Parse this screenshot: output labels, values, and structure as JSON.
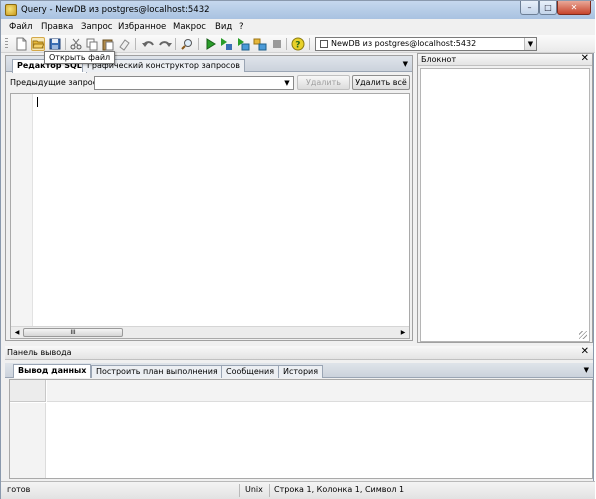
{
  "window": {
    "title": "Query - NewDB из postgres@localhost:5432",
    "controls": {
      "minimize": "–",
      "maximize": "□",
      "close": "✕"
    }
  },
  "menubar": {
    "items": [
      {
        "label": "Файл"
      },
      {
        "label": "Правка"
      },
      {
        "label": "Запрос"
      },
      {
        "label": "Избранное"
      },
      {
        "label": "Макрос"
      },
      {
        "label": "Вид"
      },
      {
        "label": "?"
      }
    ]
  },
  "toolbar": {
    "icons": [
      "new-file-icon",
      "open-file-icon",
      "save-icon",
      "cut-icon",
      "copy-icon",
      "paste-icon",
      "clear-icon",
      "undo-icon",
      "redo-icon",
      "find-icon",
      "execute-icon",
      "execute-to-file-icon",
      "explain-icon",
      "explain-analyze-icon",
      "cancel-query-icon",
      "help-icon"
    ],
    "connection": "NewDB из postgres@localhost:5432"
  },
  "tooltip": {
    "text": "Открыть файл"
  },
  "editor": {
    "tabs": [
      {
        "label": "Редактор SQL",
        "active": true
      },
      {
        "label": "Графический конструктор запросов",
        "active": false
      }
    ],
    "previous_queries_label": "Предыдущие запросы",
    "previous_queries_value": "",
    "delete_button": "Удалить",
    "delete_all_button": "Удалить всё",
    "scroll_thumb_text": "III"
  },
  "notepad": {
    "title": "Блокнот",
    "close": "✕"
  },
  "output": {
    "title": "Панель вывода",
    "close": "✕",
    "tabs": [
      {
        "label": "Вывод данных",
        "active": true
      },
      {
        "label": "Построить план выполнения",
        "active": false
      },
      {
        "label": "Сообщения",
        "active": false
      },
      {
        "label": "История",
        "active": false
      }
    ]
  },
  "statusbar": {
    "status": "готов",
    "line_endings": "Unix",
    "position": "Строка 1, Колонка 1, Символ 1"
  },
  "colors": {
    "titlebar": "#b7cde7",
    "close_button": "#c7442c",
    "execute_green": "#2a9d2a",
    "help_yellow": "#e8d12a"
  }
}
